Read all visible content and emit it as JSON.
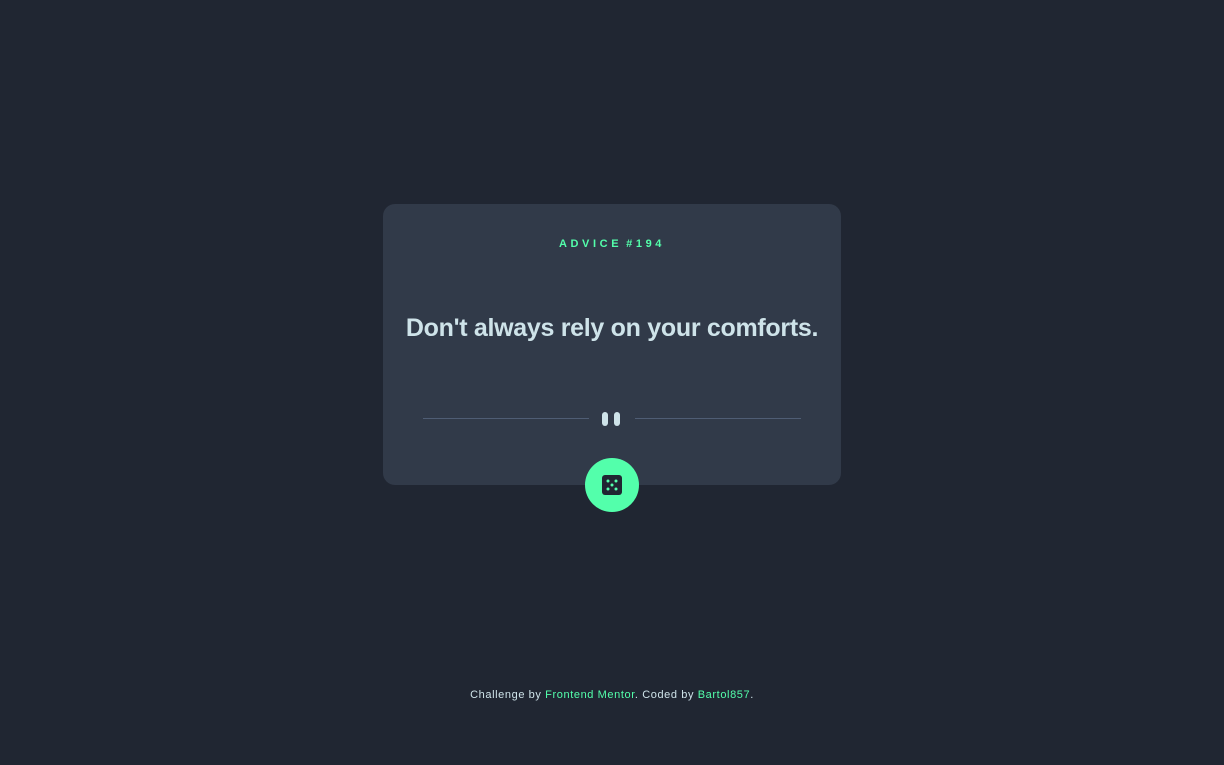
{
  "advice": {
    "label": "ADVICE",
    "number": "#194",
    "text": "Don't always rely on your comforts."
  },
  "icons": {
    "divider": "pause-icon",
    "button": "dice-icon"
  },
  "footer": {
    "prefix": "Challenge by",
    "challenge_link": "Frontend Mentor",
    "middle": ". Coded by",
    "author_link": "Bartol857",
    "suffix": "."
  },
  "colors": {
    "background": "#202632",
    "card": "#313a49",
    "accent": "#53ffab",
    "text": "#cee3e9",
    "divider": "#4f5d74"
  }
}
